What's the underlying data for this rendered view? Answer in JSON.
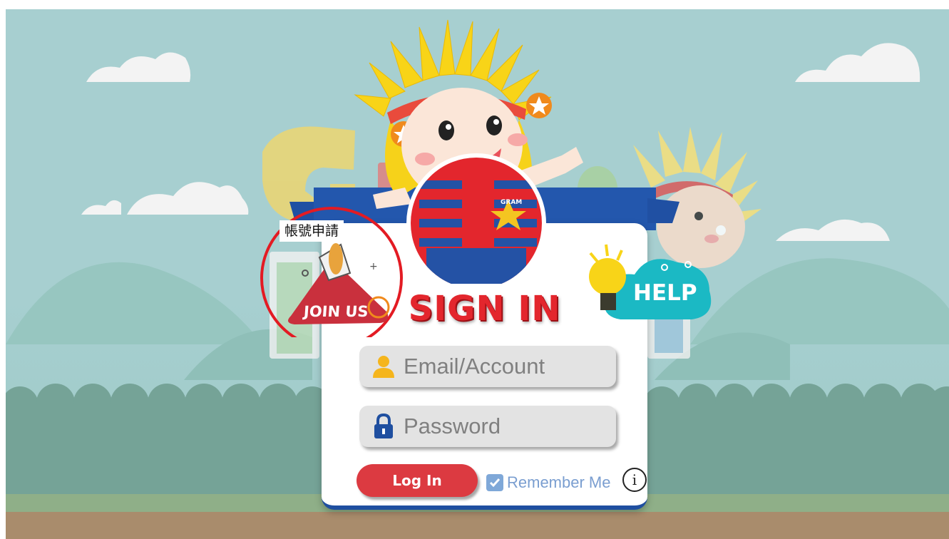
{
  "background": {
    "sky_color": "#a7cfd0",
    "hill_color": "#8fc0ba",
    "bush_color": "#75a397",
    "ground_color": "#a98c6c",
    "grass_color": "#8faf88",
    "logo_letters": "GRAM"
  },
  "mascot": {
    "badge_text": "GRAM"
  },
  "join": {
    "tag_label": "帳號申請",
    "button_label": "JOIN US",
    "highlight_color": "#e31b23"
  },
  "help": {
    "button_label": "HELP",
    "color": "#1bb9c4"
  },
  "form": {
    "title": "SIGN IN",
    "title_color": "#e3262d",
    "email_placeholder": "Email/Account",
    "password_placeholder": "Password",
    "login_label": "Log In",
    "remember_label": "Remember Me",
    "remember_checked": true,
    "info_label": "i",
    "accent_color": "#1f4fa0"
  }
}
